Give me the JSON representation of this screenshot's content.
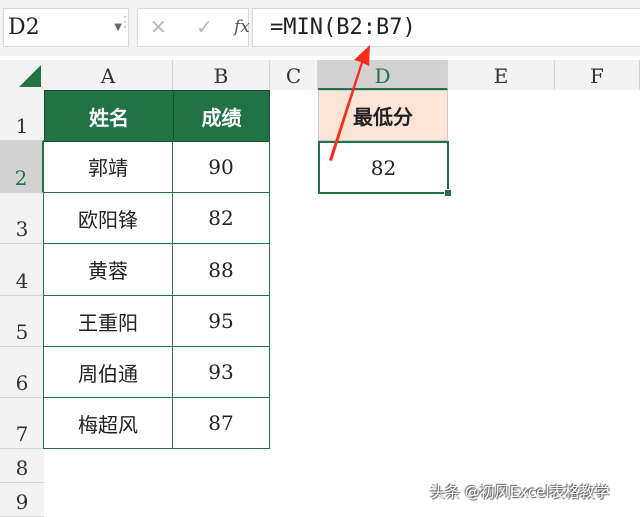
{
  "name_box": "D2",
  "formula_bar": {
    "cancel": "✕",
    "enter": "✓",
    "fx": "fx",
    "formula": "=MIN(B2:B7)"
  },
  "columns": [
    "A",
    "B",
    "C",
    "D",
    "E",
    "F"
  ],
  "rows": [
    "1",
    "2",
    "3",
    "4",
    "5",
    "6",
    "7",
    "8",
    "9"
  ],
  "table": {
    "headers": [
      "姓名",
      "成绩"
    ],
    "data": [
      [
        "郭靖",
        "90"
      ],
      [
        "欧阳锋",
        "82"
      ],
      [
        "黄蓉",
        "88"
      ],
      [
        "王重阳",
        "95"
      ],
      [
        "周伯通",
        "93"
      ],
      [
        "梅超风",
        "87"
      ]
    ]
  },
  "result": {
    "label": "最低分",
    "value": "82"
  },
  "watermark": "头条 @初风Excel表格教学",
  "colors": {
    "accent": "#217346",
    "label_bg": "#fce4d6",
    "arrow": "#ff2a1a"
  }
}
